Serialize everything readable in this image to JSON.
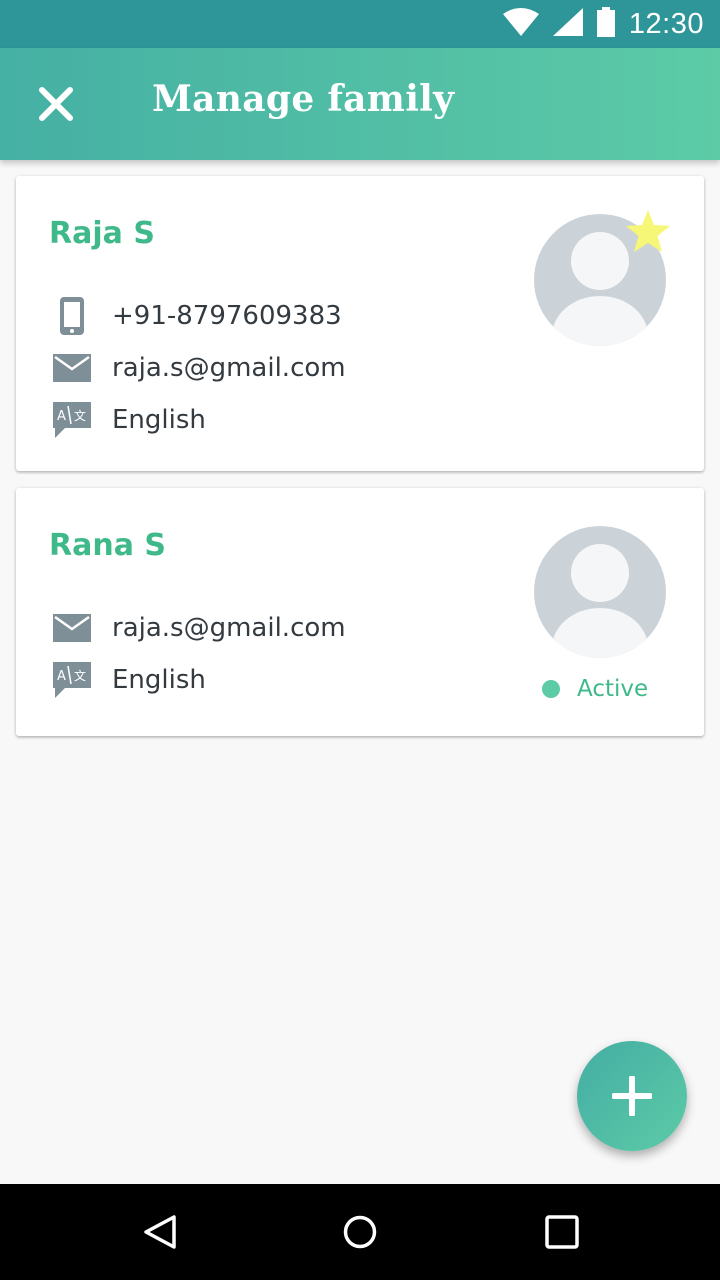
{
  "status_bar": {
    "time": "12:30",
    "icons": [
      "wifi-icon",
      "signal-icon",
      "battery-icon"
    ],
    "color": "#2e9698"
  },
  "app_bar": {
    "title": "Manage family",
    "close_icon": "close-icon",
    "gradient": [
      "#45b0a4",
      "#5ccba6"
    ]
  },
  "members": [
    {
      "name": "Raja S",
      "phone": "+91-8797609383",
      "email": "raja.s@gmail.com",
      "language": "English",
      "starred": true
    },
    {
      "name": "Rana S",
      "email": "raja.s@gmail.com",
      "language": "English",
      "status": "Active"
    }
  ],
  "colors": {
    "accent": "#3fb98a",
    "star": "#f6f776",
    "icon_gray": "#7e8f98",
    "avatar_bg": "#ccd3d8"
  },
  "fab": {
    "icon": "plus-icon"
  },
  "nav_bar": {
    "icons": [
      "back-icon",
      "home-icon",
      "recents-icon"
    ]
  }
}
